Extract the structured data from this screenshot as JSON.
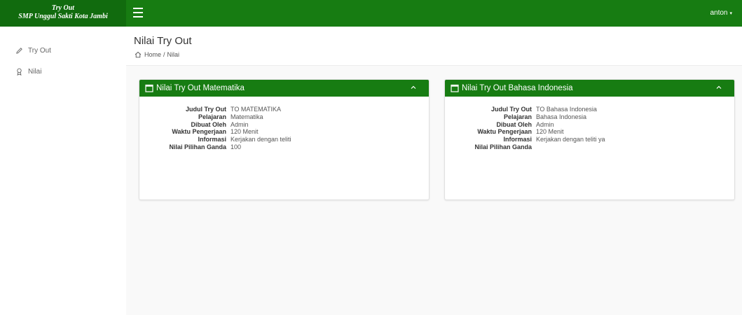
{
  "brand": {
    "line1": "Try Out",
    "line2": "SMP Unggul Sakti Kota Jambi"
  },
  "user": {
    "name": "anton",
    "caret": "▾"
  },
  "sidebar": {
    "items": [
      {
        "label": "Try Out",
        "icon": "pencil-icon"
      },
      {
        "label": "Nilai",
        "icon": "award-icon"
      }
    ]
  },
  "header": {
    "title": "Nilai Try Out",
    "breadcrumb": {
      "home": "Home",
      "separator": "/",
      "current": "Nilai"
    }
  },
  "labels": {
    "judul": "Judul Try Out",
    "pelajaran": "Pelajaran",
    "dibuat": "Dibuat Oleh",
    "waktu": "Waktu Pengerjaan",
    "informasi": "Informasi",
    "nilai": "Nilai Pilihan Ganda"
  },
  "cards": [
    {
      "title": "Nilai Try Out Matematika",
      "judul": "TO MATEMATIKA",
      "pelajaran": "Matematika",
      "dibuat": "Admin",
      "waktu": "120 Menit",
      "informasi": "Kerjakan dengan teliti",
      "nilai": "100"
    },
    {
      "title": "Nilai Try Out Bahasa Indonesia",
      "judul": "TO Bahasa Indonesia",
      "pelajaran": "Bahasa Indonesia",
      "dibuat": "Admin",
      "waktu": "120 Menit",
      "informasi": "Kerjakan dengan teliti ya",
      "nilai": ""
    }
  ],
  "colors": {
    "primary": "#177c12",
    "brand_bg": "#116b0e",
    "content_bg": "#f9f9f9"
  }
}
